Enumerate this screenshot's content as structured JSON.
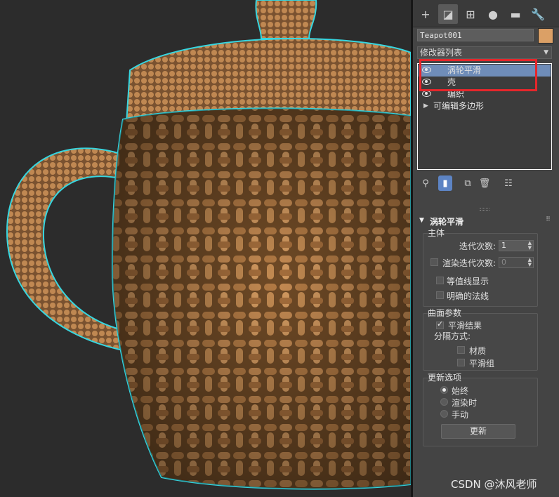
{
  "window": {
    "watermark": "CSDN @沐风老师"
  },
  "command_panel": {
    "tabs": [
      {
        "icon": "plus-icon",
        "glyph": "+"
      },
      {
        "icon": "modify-icon",
        "glyph": "◪"
      },
      {
        "icon": "hierarchy-icon",
        "glyph": "⊞"
      },
      {
        "icon": "motion-icon",
        "glyph": "●"
      },
      {
        "icon": "display-icon",
        "glyph": "▬"
      },
      {
        "icon": "utilities-icon",
        "glyph": "🔧"
      }
    ],
    "object_name": "Teapot001",
    "object_color": "#dba066",
    "modifier_list_label": "修改器列表",
    "stack": [
      {
        "label": "涡轮平滑",
        "selected": true,
        "eye": true
      },
      {
        "label": "壳",
        "selected": false,
        "eye": true
      },
      {
        "label": "编织",
        "selected": false,
        "eye": true
      },
      {
        "label": "可编辑多边形",
        "selected": false,
        "eye": false,
        "expand": true
      }
    ],
    "highlight_color": "#e5262b",
    "rollout": {
      "title": "涡轮平滑",
      "main_group": {
        "title": "主体",
        "iterations_label": "迭代次数:",
        "iterations_value": "1",
        "render_iters_label": "渲染迭代次数:",
        "render_iters_value": "0",
        "isoline_label": "等值线显示",
        "explicit_normals_label": "明确的法线"
      },
      "surface_group": {
        "title": "曲面参数",
        "smooth_result_label": "平滑结果",
        "separate_label": "分隔方式:",
        "materials_label": "材质",
        "smoothing_groups_label": "平滑组"
      },
      "update_group": {
        "title": "更新选项",
        "always_label": "始终",
        "when_rendering_label": "渲染时",
        "manually_label": "手动",
        "update_button": "更新"
      }
    }
  },
  "viewport": {
    "outline_color": "#37d6e0",
    "teapot_color": "#b8824c"
  }
}
